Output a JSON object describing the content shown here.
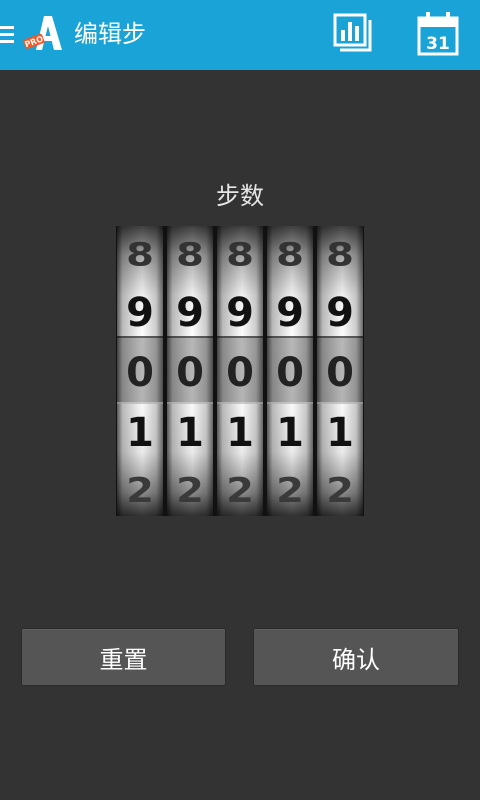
{
  "appbar": {
    "title": "编辑步",
    "logo_text": "PRO",
    "calendar_day": "31",
    "color": "#1aa3d6"
  },
  "icons": {
    "drawer": "hamburger-icon",
    "logo": "app-logo-icon",
    "stats": "bar-chart-icon",
    "calendar": "calendar-icon"
  },
  "main": {
    "label": "步数",
    "wheels": [
      {
        "digits": [
          "8",
          "9",
          "0",
          "1",
          "2"
        ],
        "selected": "0"
      },
      {
        "digits": [
          "8",
          "9",
          "0",
          "1",
          "2"
        ],
        "selected": "0"
      },
      {
        "digits": [
          "8",
          "9",
          "0",
          "1",
          "2"
        ],
        "selected": "0"
      },
      {
        "digits": [
          "8",
          "9",
          "0",
          "1",
          "2"
        ],
        "selected": "0"
      },
      {
        "digits": [
          "8",
          "9",
          "0",
          "1",
          "2"
        ],
        "selected": "0"
      }
    ]
  },
  "buttons": {
    "reset": "重置",
    "confirm": "确认"
  }
}
